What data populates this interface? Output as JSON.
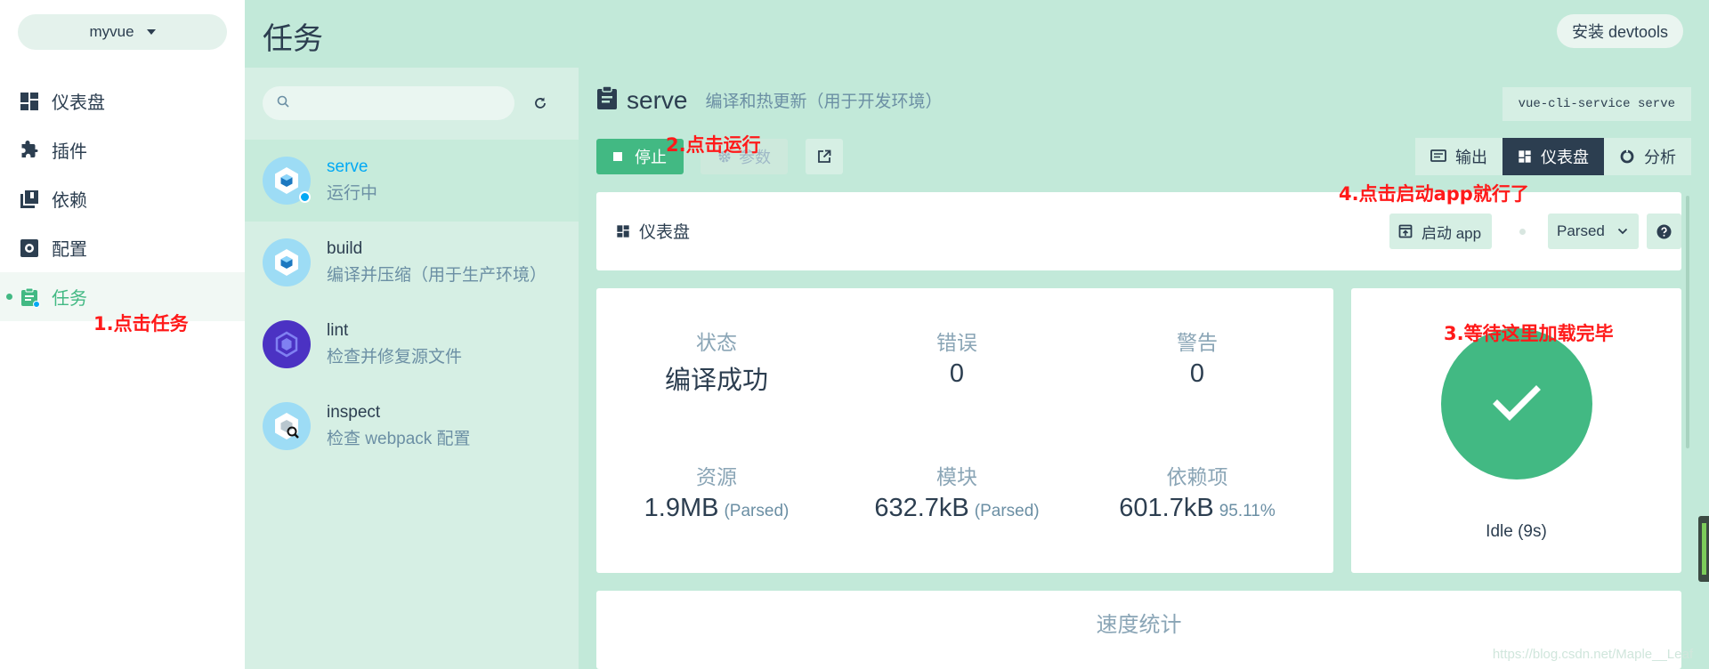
{
  "project_selector": {
    "label": "myvue"
  },
  "nav": {
    "items": [
      {
        "label": "仪表盘",
        "icon": "dashboard-icon"
      },
      {
        "label": "插件",
        "icon": "puzzle-icon"
      },
      {
        "label": "依赖",
        "icon": "library-icon"
      },
      {
        "label": "配置",
        "icon": "settings-icon"
      },
      {
        "label": "任务",
        "icon": "clipboard-icon",
        "active": true
      }
    ]
  },
  "topbar": {
    "title": "任务",
    "devtools_label": "安装 devtools"
  },
  "task_list": {
    "search": {
      "value": "",
      "placeholder": ""
    },
    "tasks": [
      {
        "name": "serve",
        "desc": "运行中",
        "selected": true,
        "running": true
      },
      {
        "name": "build",
        "desc": "编译并压缩（用于生产环境）"
      },
      {
        "name": "lint",
        "desc": "检查并修复源文件"
      },
      {
        "name": "inspect",
        "desc": "检查 webpack 配置"
      }
    ]
  },
  "main": {
    "task_title": "serve",
    "task_subtitle": "编译和热更新（用于开发环境）",
    "command": "vue-cli-service serve",
    "stop_label": "停止",
    "params_label": "参数",
    "view_tabs": [
      {
        "label": "输出",
        "icon": "terminal-icon"
      },
      {
        "label": "仪表盘",
        "icon": "dashboard-icon",
        "active": true
      },
      {
        "label": "分析",
        "icon": "donut-icon"
      }
    ],
    "dashboard": {
      "label": "仪表盘",
      "start_app_label": "启动 app",
      "mode_select": "Parsed"
    },
    "stats": {
      "status": {
        "label": "状态",
        "value": "编译成功"
      },
      "errors": {
        "label": "错误",
        "value": "0"
      },
      "warnings": {
        "label": "警告",
        "value": "0"
      },
      "assets": {
        "label": "资源",
        "value": "1.9MB",
        "unit": "(Parsed)"
      },
      "modules": {
        "label": "模块",
        "value": "632.7kB",
        "unit": "(Parsed)"
      },
      "dependencies": {
        "label": "依赖项",
        "value": "601.7kB",
        "unit": "95.11%"
      }
    },
    "status_card": {
      "text": "Idle (9s)",
      "state": "success"
    },
    "speed_title": "速度统计"
  },
  "annotations": {
    "a1": "1.点击任务",
    "a2": "2.点击运行",
    "a3": "3.等待这里加载完毕",
    "a4": "4.点击启动app就行了"
  },
  "watermark": "https://blog.csdn.net/Maple__Leaf",
  "colors": {
    "accent": "#42b983",
    "dark": "#2c3e50",
    "running": "#03a9f4",
    "annotation": "#ff1a1a"
  }
}
